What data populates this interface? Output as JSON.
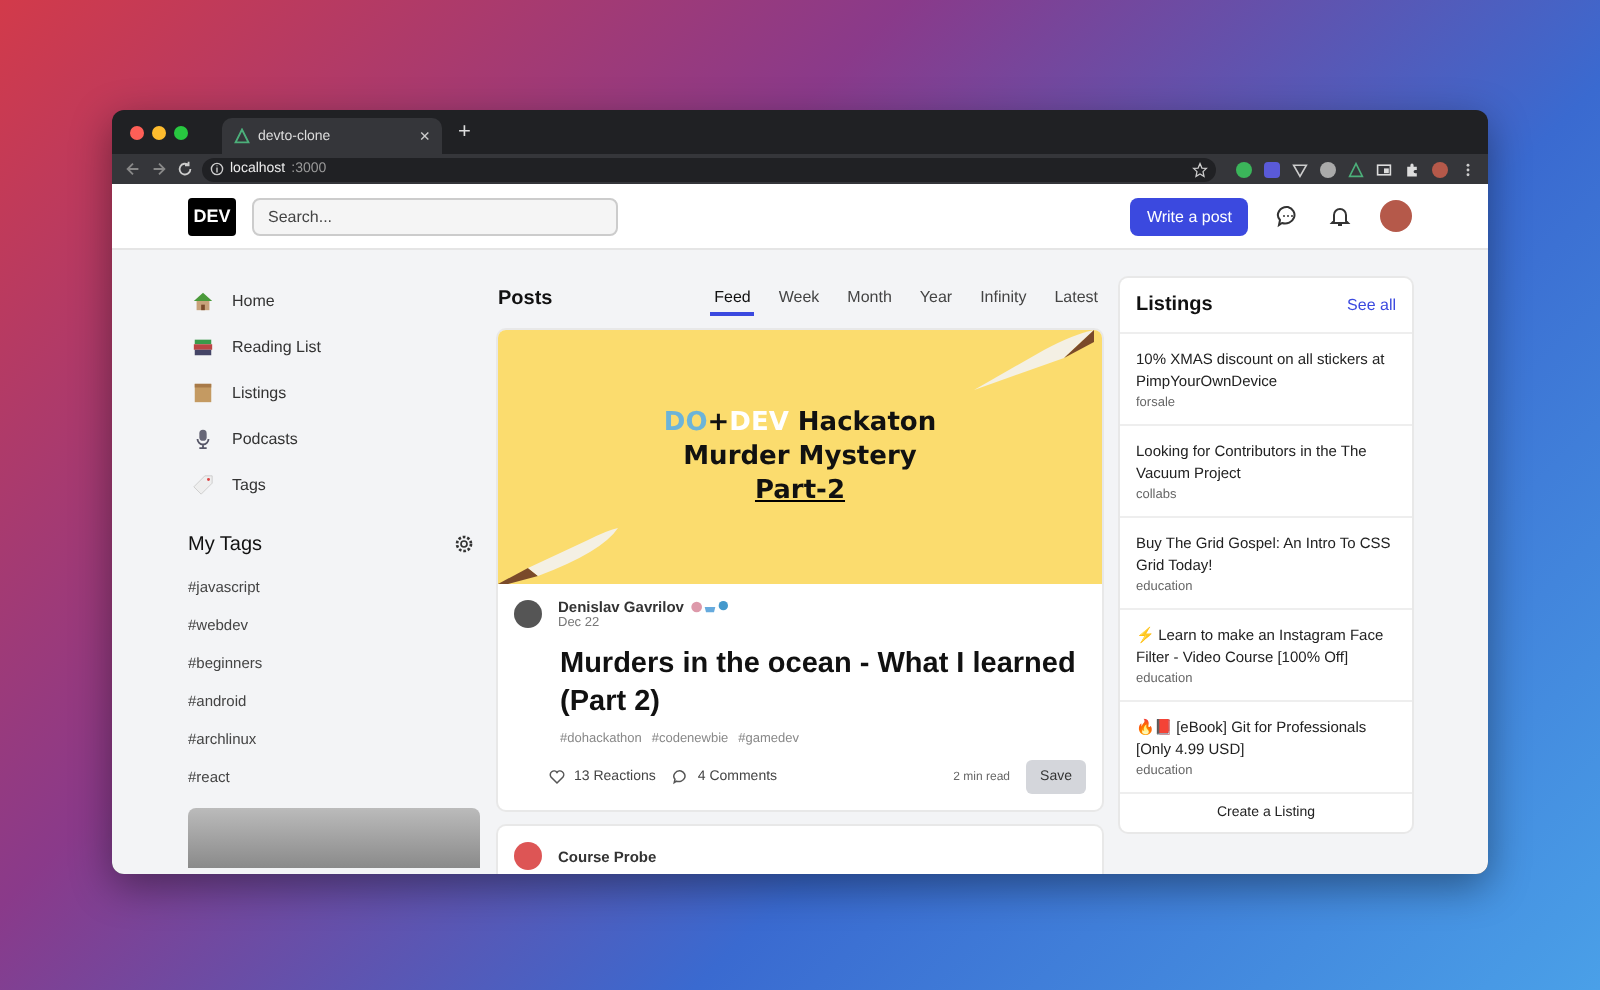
{
  "browser": {
    "tab": {
      "title": "devto-clone",
      "close": "×"
    },
    "new_tab": "+",
    "address": {
      "host": "localhost",
      "port": ":3000"
    }
  },
  "header": {
    "logo": "DEV",
    "search": {
      "placeholder": "Search..."
    },
    "write_button": "Write a post"
  },
  "sidebar": {
    "items": [
      {
        "label": "Home",
        "kind": "home"
      },
      {
        "label": "Reading List",
        "kind": "books"
      },
      {
        "label": "Listings",
        "kind": "box"
      },
      {
        "label": "Podcasts",
        "kind": "mic"
      },
      {
        "label": "Tags",
        "kind": "tag"
      }
    ],
    "my_tags": {
      "title": "My Tags",
      "tags": [
        "#javascript",
        "#webdev",
        "#beginners",
        "#android",
        "#archlinux",
        "#react"
      ]
    }
  },
  "posts": {
    "title": "Posts",
    "tabs": [
      {
        "label": "Feed",
        "selected": true
      },
      {
        "label": "Week",
        "selected": false
      },
      {
        "label": "Month",
        "selected": false
      },
      {
        "label": "Year",
        "selected": false
      },
      {
        "label": "Infinity",
        "selected": false
      },
      {
        "label": "Latest",
        "selected": false
      }
    ],
    "featured": {
      "banner": {
        "lines": [
          [
            {
              "text": "DO",
              "color": "#6cb4d8"
            },
            {
              "text": "+",
              "color": "#111111"
            },
            {
              "text": "DEV",
              "color": "#ffffff"
            },
            {
              "text": " Hackaton",
              "color": "#111111"
            }
          ],
          [
            {
              "text": "Murder Mystery",
              "color": "#111111"
            }
          ],
          [
            {
              "text": "Part-2",
              "color": "#111111"
            }
          ]
        ]
      },
      "author": "Denislav Gavrilov",
      "date": "Dec 22",
      "title": "Murders in the ocean - What I learned (Part 2)",
      "tags": [
        "#dohackathon",
        "#codenewbie",
        "#gamedev"
      ],
      "reactions": "13 Reactions",
      "comments": "4 Comments",
      "read_time": "2 min read",
      "save": "Save"
    },
    "next_post": {
      "author": "Course Probe"
    }
  },
  "listings": {
    "title": "Listings",
    "see_all": "See all",
    "items": [
      {
        "title": "10% XMAS discount on all stickers at PimpYourOwnDevice",
        "category": "forsale"
      },
      {
        "title": "Looking for Contributors in the The Vacuum Project",
        "category": "collabs"
      },
      {
        "title": "Buy The Grid Gospel: An Intro To CSS Grid Today!",
        "category": "education"
      },
      {
        "title": "⚡ Learn to make an Instagram Face Filter - Video Course [100% Off]",
        "category": "education"
      },
      {
        "title": "🔥📕 [eBook] Git for Professionals [Only 4.99 USD]",
        "category": "education"
      }
    ],
    "create": "Create a Listing"
  }
}
